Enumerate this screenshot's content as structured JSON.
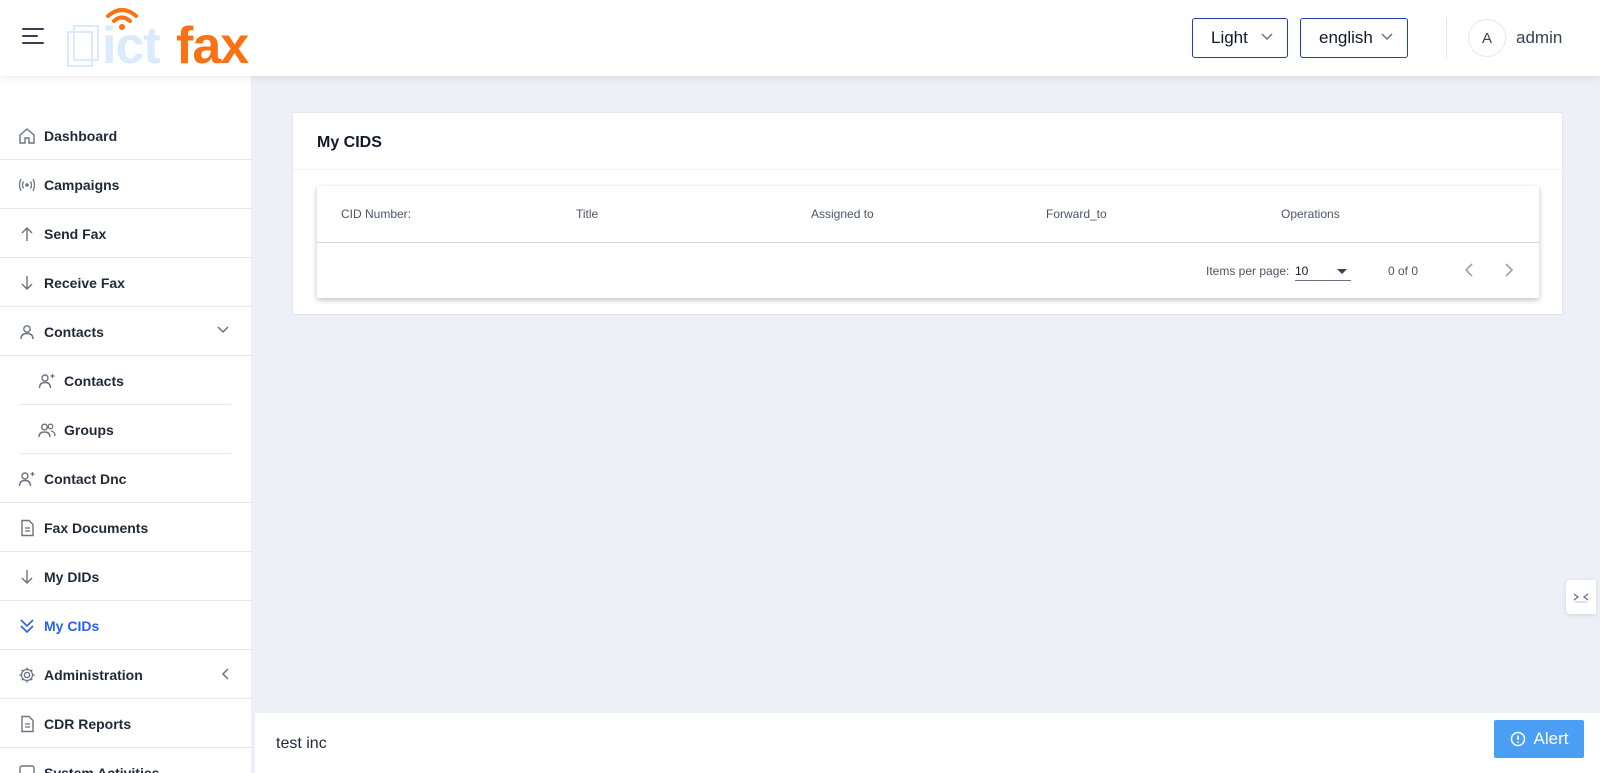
{
  "header": {
    "logo_left": "ict",
    "logo_right": "fax",
    "theme_value": "Light",
    "language_value": "english",
    "avatar_initial": "A",
    "username": "admin"
  },
  "sidebar": {
    "items": [
      {
        "label": "Dashboard",
        "icon": "home-icon"
      },
      {
        "label": "Campaigns",
        "icon": "broadcast-icon"
      },
      {
        "label": "Send Fax",
        "icon": "arrow-up-icon"
      },
      {
        "label": "Receive Fax",
        "icon": "arrow-down-icon"
      },
      {
        "label": "Contacts",
        "icon": "user-icon"
      },
      {
        "label": "Contacts",
        "icon": "user-plus-icon"
      },
      {
        "label": "Groups",
        "icon": "users-icon"
      },
      {
        "label": "Contact Dnc",
        "icon": "user-plus-icon"
      },
      {
        "label": "Fax Documents",
        "icon": "document-icon"
      },
      {
        "label": "My DIDs",
        "icon": "arrow-down-icon"
      },
      {
        "label": "My CIDs",
        "icon": "chevrons-down-icon"
      },
      {
        "label": "Administration",
        "icon": "gear-icon"
      },
      {
        "label": "CDR Reports",
        "icon": "document-icon"
      },
      {
        "label": "System Activities",
        "icon": "square-icon"
      }
    ]
  },
  "main": {
    "title": "My CIDS",
    "columns": [
      "CID Number:",
      "Title",
      "Assigned to",
      "Forward_to",
      "Operations"
    ],
    "rows": [],
    "paginator": {
      "items_per_page_label": "Items per page:",
      "items_per_page_value": "10",
      "range_label": "0 of 0"
    }
  },
  "footer": {
    "company": "test inc",
    "alert_label": "Alert"
  },
  "colors": {
    "accent": "#2563eb",
    "brand_orange": "#f97316",
    "alert_blue": "#4a9ff5",
    "background": "#edf0f7"
  }
}
